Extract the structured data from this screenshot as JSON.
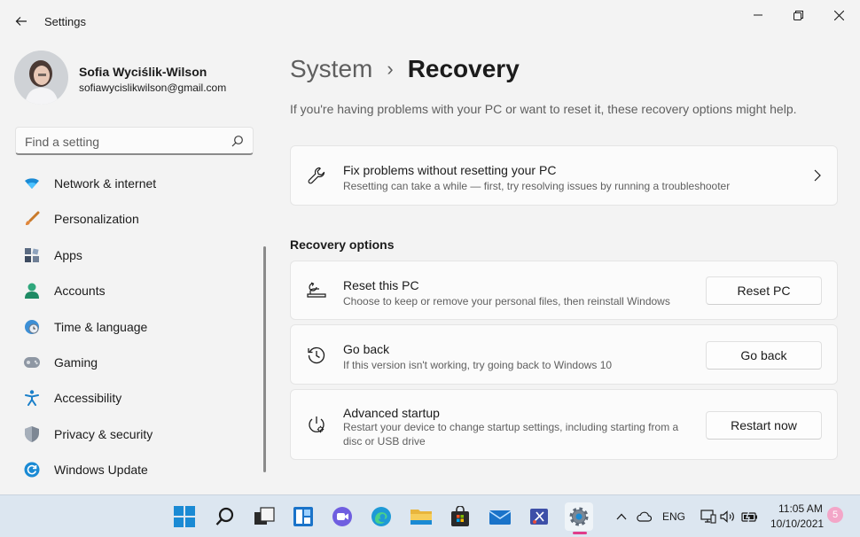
{
  "app": {
    "title": "Settings"
  },
  "user": {
    "name": "Sofia Wyciślik-Wilson",
    "email": "sofiawycislikwilson@gmail.com"
  },
  "search": {
    "placeholder": "Find a setting"
  },
  "nav": [
    {
      "label": "Network & internet",
      "icon": "wifi-icon"
    },
    {
      "label": "Personalization",
      "icon": "brush-icon"
    },
    {
      "label": "Apps",
      "icon": "apps-icon"
    },
    {
      "label": "Accounts",
      "icon": "person-icon"
    },
    {
      "label": "Time & language",
      "icon": "globe-clock-icon"
    },
    {
      "label": "Gaming",
      "icon": "gamepad-icon"
    },
    {
      "label": "Accessibility",
      "icon": "accessibility-icon"
    },
    {
      "label": "Privacy & security",
      "icon": "shield-icon"
    },
    {
      "label": "Windows Update",
      "icon": "update-icon"
    }
  ],
  "page": {
    "breadcrumb_parent": "System",
    "breadcrumb_sep": "›",
    "title": "Recovery",
    "intro": "If you're having problems with your PC or want to reset it, these recovery options might help."
  },
  "fix_card": {
    "title": "Fix problems without resetting your PC",
    "desc": "Resetting can take a while — first, try resolving issues by running a troubleshooter"
  },
  "section": {
    "heading": "Recovery options"
  },
  "options": [
    {
      "title": "Reset this PC",
      "desc": "Choose to keep or remove your personal files, then reinstall Windows",
      "button": "Reset PC"
    },
    {
      "title": "Go back",
      "desc": "If this version isn't working, try going back to Windows 10",
      "button": "Go back"
    },
    {
      "title": "Advanced startup",
      "desc": "Restart your device to change startup settings, including starting from a disc or USB drive",
      "button": "Restart now"
    }
  ],
  "tray": {
    "lang": "ENG",
    "time": "11:05 AM",
    "date": "10/10/2021",
    "notifications": "5"
  },
  "colors": {
    "accent": "#0067c0",
    "taskbar": "#dce6f0",
    "background": "#f3f3f3"
  }
}
